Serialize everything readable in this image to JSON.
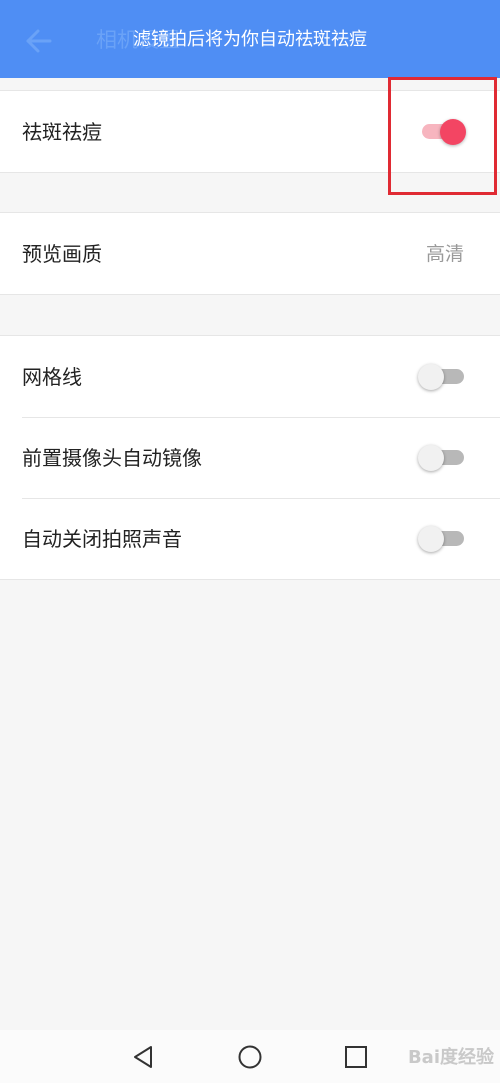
{
  "header": {
    "title": "相机设置",
    "toast": "滤镜拍后将为你自动祛斑祛痘"
  },
  "groups": [
    {
      "rows": [
        {
          "label": "祛斑祛痘",
          "toggle": "on"
        }
      ]
    },
    {
      "rows": [
        {
          "label": "预览画质",
          "value": "高清"
        }
      ]
    },
    {
      "rows": [
        {
          "label": "网格线",
          "toggle": "off"
        },
        {
          "label": "前置摄像头自动镜像",
          "toggle": "off"
        },
        {
          "label": "自动关闭拍照声音",
          "toggle": "off"
        }
      ]
    }
  ],
  "colors": {
    "header_bg": "#4f8ef4",
    "toggle_on": "#f34563",
    "highlight": "#e02a33"
  },
  "icons": {
    "back": "arrow-left-icon",
    "nav_back": "triangle-back-icon",
    "nav_home": "circle-home-icon",
    "nav_recents": "square-recents-icon"
  },
  "watermark": "Bai度经验"
}
